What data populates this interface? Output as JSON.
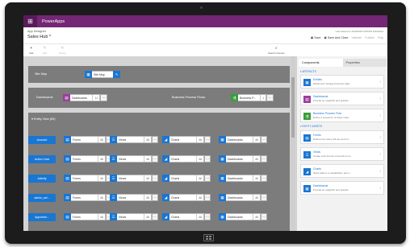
{
  "app": {
    "name": "PowerApps",
    "designer_label": "App Designer",
    "app_name": "Sales Hub *",
    "status": "Last Saved on 3/20/2019 9:58 PM Published",
    "save_label": "Save",
    "save_close_label": "Save And Close",
    "validate_label": "Validate",
    "publish_label": "Publish",
    "play_label": "Play"
  },
  "toolbar": {
    "add_label": "Add",
    "edit_label": "Edit",
    "delete_label": "Delete",
    "search_label": "Search Canvas"
  },
  "canvas": {
    "sitemap": {
      "label": "Site Map",
      "chip": "Site Map"
    },
    "dashboards": {
      "label": "Dashboards",
      "chip": "Dashboards",
      "count": "11"
    },
    "bpf": {
      "label": "Business Process Flows",
      "chip": "Business P...",
      "count": "1"
    },
    "entity_view": {
      "label": "Entity View (83)"
    },
    "rows": [
      {
        "entity": "Account",
        "forms": "Forms",
        "views": "Views",
        "charts": "Charts",
        "dashboards": "Dashboards",
        "all": "All"
      },
      {
        "entity": "Action Card",
        "forms": "Forms",
        "views": "Views",
        "charts": "Charts",
        "dashboards": "Dashboards",
        "all": "All"
      },
      {
        "entity": "Activity",
        "forms": "Forms",
        "views": "Views",
        "charts": "Charts",
        "dashboards": "Dashboards",
        "all": "All"
      },
      {
        "entity": "admin_set...",
        "forms": "Forms",
        "views": "Views",
        "charts": "Charts",
        "dashboards": "Dashboards",
        "all": "All"
      },
      {
        "entity": "Appointm...",
        "forms": "Forms",
        "views": "Views",
        "charts": "Charts",
        "dashboards": "Dashboards",
        "all": "All"
      }
    ]
  },
  "panel": {
    "tabs": [
      "Components",
      "Properties"
    ],
    "artifacts_header": "ARTIFACTS",
    "artifacts": [
      {
        "title": "Entities",
        "desc": "Model and manage business data"
      },
      {
        "title": "Dashboards",
        "desc": "Provide an insightful and graphic..."
      },
      {
        "title": "Business Process Flow",
        "desc": "Define a sequence of steps requi..."
      }
    ],
    "entity_assets_header": "ENTITY ASSETS",
    "entity_assets": [
      {
        "title": "Forms",
        "desc": "Define how users will see and int..."
      },
      {
        "title": "Views",
        "desc": "Create a list format of records for a..."
      },
      {
        "title": "Charts",
        "desc": "Show data in a visualization and c..."
      },
      {
        "title": "Dashboards",
        "desc": "Provide an insightful and graphic..."
      }
    ]
  },
  "colors": {
    "brand": "#742774",
    "blue": "#1976d2",
    "dashboard": "#9c3f9c",
    "bpf": "#3a9d3a",
    "canvas": "#d4d4d4",
    "section": "#7c7c7c"
  }
}
